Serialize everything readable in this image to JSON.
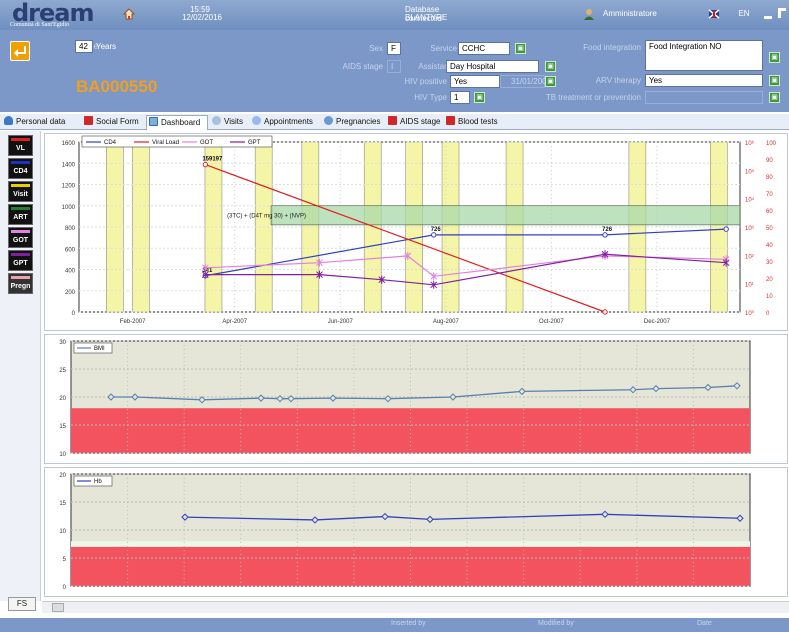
{
  "app": {
    "logo": "dream",
    "subtitle": "Comunità di Sant'Egidio",
    "time": "15:59",
    "date": "12/02/2016",
    "db_status": "Database connected",
    "db_name": "BLANTYRE",
    "user": "Amministratore",
    "lang": "EN"
  },
  "patient": {
    "age_label": "Age",
    "age_value": "42",
    "age_unit": "Years",
    "code": "BA000550",
    "sex_label": "Sex",
    "sex_value": "F",
    "aids_stage_label": "AIDS stage",
    "aids_stage_value": "I",
    "service_label": "Service",
    "service_value": "CCHC",
    "assistance_label": "Assistance",
    "assistance_value": "Day Hospital",
    "hiv_positive_label": "HIV positive",
    "hiv_positive_value": "Yes",
    "hiv_positive_date": "31/01/2007",
    "hiv_type_label": "HIV Type",
    "hiv_type_value": "1",
    "food_label": "Food integration",
    "food_value": "Food Integration NO",
    "arv_label": "ARV therapy",
    "arv_value": "Yes",
    "tb_label": "TB treatment or prevention",
    "tb_value": ""
  },
  "tabs": [
    {
      "label": "Personal data",
      "icon": "person-icon"
    },
    {
      "label": "Social Form",
      "icon": "form-icon"
    },
    {
      "label": "Dashboard",
      "icon": "dashboard-icon"
    },
    {
      "label": "Visits",
      "icon": "stethoscope-icon"
    },
    {
      "label": "Appointments",
      "icon": "clock-icon"
    },
    {
      "label": "Pregnancies",
      "icon": "pregnancy-icon"
    },
    {
      "label": "AIDS stage",
      "icon": "aids-icon"
    },
    {
      "label": "Blood tests",
      "icon": "blood-icon"
    }
  ],
  "legend_buttons": [
    {
      "label": "VL",
      "color": "#e02020"
    },
    {
      "label": "CD4",
      "color": "#2030c0"
    },
    {
      "label": "Visit",
      "color": "#e8d000"
    },
    {
      "label": "ART",
      "color": "#208030"
    },
    {
      "label": "GOT",
      "color": "#e080e0"
    },
    {
      "label": "GPT",
      "color": "#8020a0"
    },
    {
      "label": "Pregn",
      "color": "#f0a0b0"
    }
  ],
  "footer": {
    "fs_label": "FS",
    "inserted_by": "Inserted by",
    "modified_by": "Modified by",
    "date_label": "Date"
  },
  "chart_data": [
    {
      "type": "line",
      "legend": [
        "CD4",
        "Viral Load",
        "GOT",
        "GPT"
      ],
      "x_ticks": [
        "Feb-2007",
        "Apr-2007",
        "Jun-2007",
        "Aug-2007",
        "Oct-2007",
        "Dec-2007"
      ],
      "ylim_left": [
        0,
        1600
      ],
      "y_ticks_left": [
        0,
        200,
        400,
        600,
        800,
        1000,
        1200,
        1400,
        1600
      ],
      "y_ticks_right": [
        0,
        10,
        20,
        30,
        40,
        50,
        60,
        70,
        80,
        90,
        100
      ],
      "therapy_label": "(3TC) + (D4T mg 30) + (NVP)",
      "series": [
        {
          "name": "CD4",
          "color": "#3040c0",
          "x": [
            "2007-03-15",
            "2007-07-25",
            "2007-11-01",
            "2008-01-10"
          ],
          "y": [
            341,
            726,
            726,
            780
          ],
          "labels": [
            "341",
            "726",
            "726",
            ""
          ]
        },
        {
          "name": "Viral Load",
          "color": "#e02020",
          "x": [
            "2007-03-15",
            "2007-11-01"
          ],
          "y": [
            159197,
            1
          ],
          "labels": [
            "159197",
            ""
          ]
        },
        {
          "name": "GOT",
          "color": "#e080e0",
          "x": [
            "2007-03-15",
            "2007-05-20",
            "2007-07-10",
            "2007-07-25",
            "2007-11-01",
            "2008-01-10"
          ],
          "y": [
            26,
            29,
            33,
            21,
            33,
            31
          ]
        },
        {
          "name": "GPT",
          "color": "#8020a0",
          "x": [
            "2007-03-15",
            "2007-05-20",
            "2007-06-25",
            "2007-07-25",
            "2007-11-01",
            "2008-01-10"
          ],
          "y": [
            22,
            22,
            19,
            16,
            34,
            29
          ]
        }
      ]
    },
    {
      "type": "line",
      "legend": [
        "BMI"
      ],
      "ylim": [
        10,
        30
      ],
      "y_ticks": [
        10,
        15,
        20,
        25,
        30
      ],
      "normal_band_below": 18,
      "series": [
        {
          "name": "BMI",
          "color": "#5580b0",
          "y": [
            20,
            20,
            19.5,
            19.8,
            19.7,
            19.7,
            19.8,
            19.7,
            20,
            21,
            21.3,
            21.5,
            21.7,
            22,
            21.8
          ]
        }
      ]
    },
    {
      "type": "line",
      "legend": [
        "Hb"
      ],
      "ylim": [
        0,
        20
      ],
      "y_ticks": [
        0,
        5,
        10,
        15,
        20
      ],
      "normal_band_below": 7,
      "series": [
        {
          "name": "Hb",
          "color": "#3040c0",
          "y": [
            12.3,
            11.8,
            12.4,
            11.9,
            12.8,
            12.1
          ]
        }
      ]
    }
  ]
}
